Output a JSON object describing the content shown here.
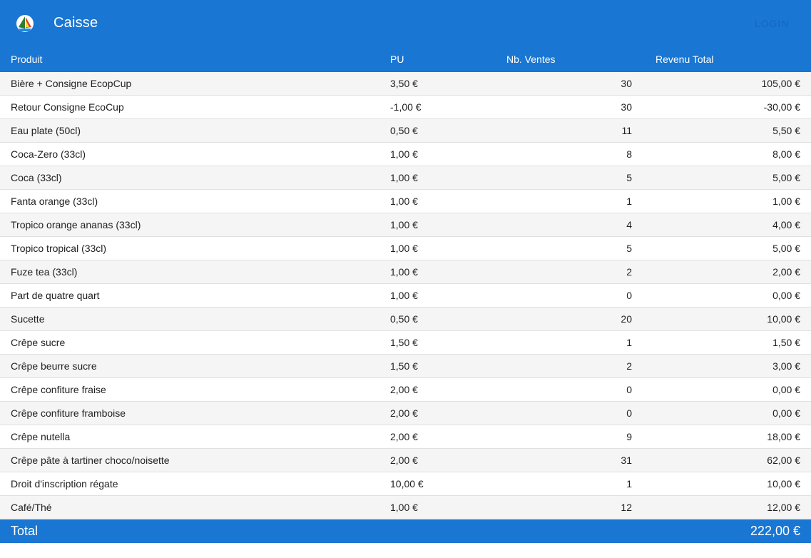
{
  "app": {
    "title": "Caisse",
    "login_label": "LOGIN",
    "logo_icon": "sailboat-icon"
  },
  "colors": {
    "primary": "#1976d2",
    "row_alt": "#f5f5f5"
  },
  "table": {
    "columns": [
      "Produit",
      "PU",
      "Nb. Ventes",
      "Revenu Total"
    ],
    "rows": [
      {
        "produit": "Bière + Consigne EcopCup",
        "pu": "3,50 €",
        "ventes": "30",
        "revenu": "105,00 €"
      },
      {
        "produit": "Retour Consigne EcoCup",
        "pu": "-1,00 €",
        "ventes": "30",
        "revenu": "-30,00 €"
      },
      {
        "produit": "Eau plate (50cl)",
        "pu": "0,50 €",
        "ventes": "11",
        "revenu": "5,50 €"
      },
      {
        "produit": "Coca-Zero (33cl)",
        "pu": "1,00 €",
        "ventes": "8",
        "revenu": "8,00 €"
      },
      {
        "produit": "Coca (33cl)",
        "pu": "1,00 €",
        "ventes": "5",
        "revenu": "5,00 €"
      },
      {
        "produit": "Fanta orange (33cl)",
        "pu": "1,00 €",
        "ventes": "1",
        "revenu": "1,00 €"
      },
      {
        "produit": "Tropico orange ananas (33cl)",
        "pu": "1,00 €",
        "ventes": "4",
        "revenu": "4,00 €"
      },
      {
        "produit": "Tropico tropical (33cl)",
        "pu": "1,00 €",
        "ventes": "5",
        "revenu": "5,00 €"
      },
      {
        "produit": "Fuze tea (33cl)",
        "pu": "1,00 €",
        "ventes": "2",
        "revenu": "2,00 €"
      },
      {
        "produit": "Part de quatre quart",
        "pu": "1,00 €",
        "ventes": "0",
        "revenu": "0,00 €"
      },
      {
        "produit": "Sucette",
        "pu": "0,50 €",
        "ventes": "20",
        "revenu": "10,00 €"
      },
      {
        "produit": "Crêpe sucre",
        "pu": "1,50 €",
        "ventes": "1",
        "revenu": "1,50 €"
      },
      {
        "produit": "Crêpe beurre sucre",
        "pu": "1,50 €",
        "ventes": "2",
        "revenu": "3,00 €"
      },
      {
        "produit": "Crêpe confiture fraise",
        "pu": "2,00 €",
        "ventes": "0",
        "revenu": "0,00 €"
      },
      {
        "produit": "Crêpe confiture framboise",
        "pu": "2,00 €",
        "ventes": "0",
        "revenu": "0,00 €"
      },
      {
        "produit": "Crêpe nutella",
        "pu": "2,00 €",
        "ventes": "9",
        "revenu": "18,00 €"
      },
      {
        "produit": "Crêpe pâte à tartiner choco/noisette",
        "pu": "2,00 €",
        "ventes": "31",
        "revenu": "62,00 €"
      },
      {
        "produit": "Droit d'inscription régate",
        "pu": "10,00 €",
        "ventes": "1",
        "revenu": "10,00 €"
      },
      {
        "produit": "Café/Thé",
        "pu": "1,00 €",
        "ventes": "12",
        "revenu": "12,00 €"
      }
    ]
  },
  "total": {
    "label": "Total",
    "value": "222,00 €"
  }
}
